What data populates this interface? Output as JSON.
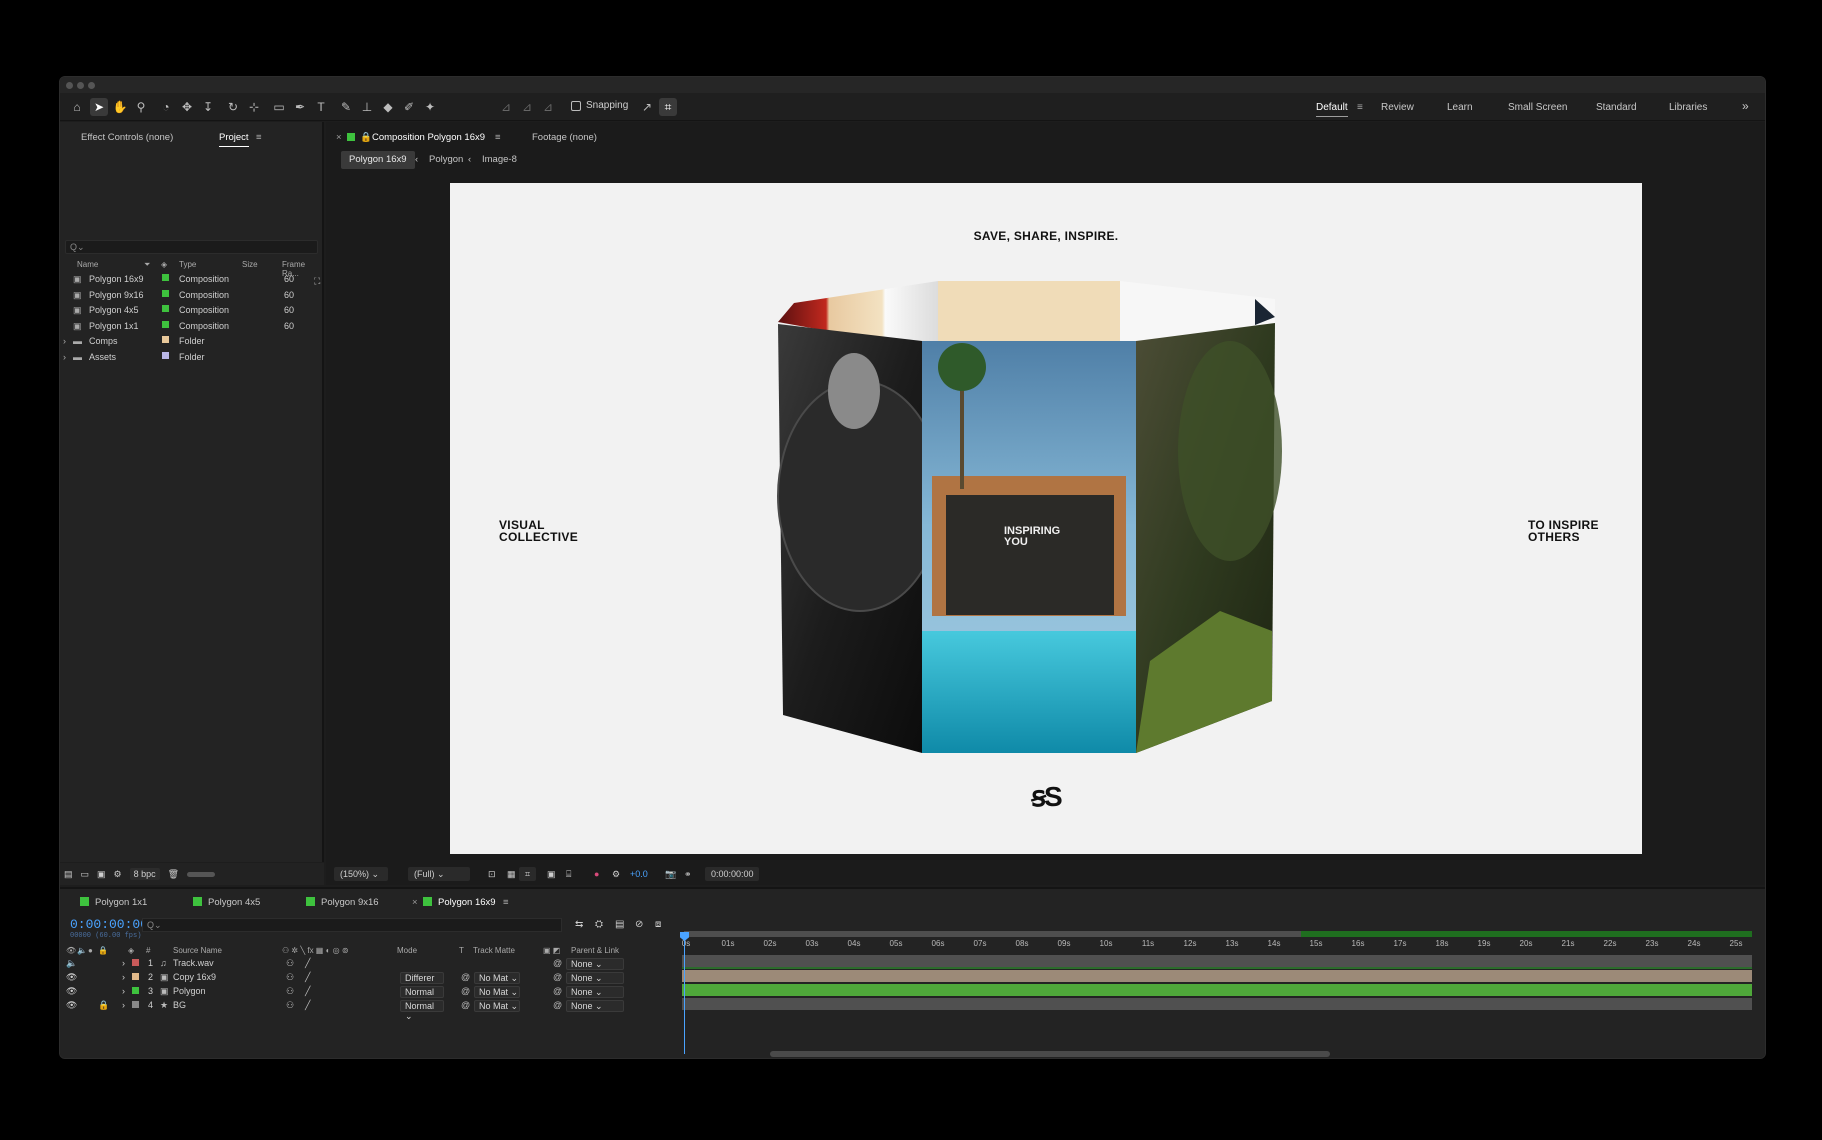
{
  "toolbar": {
    "snapping_label": "Snapping",
    "workspaces": [
      "Default",
      "Review",
      "Learn",
      "Small Screen",
      "Standard",
      "Libraries"
    ],
    "active_workspace": "Default",
    "more_icon": "»"
  },
  "left_panel": {
    "tabs": [
      "Effect Controls (none)",
      "Project"
    ],
    "search_placeholder": "Q⌄",
    "columns": [
      "Name",
      "Type",
      "Size",
      "Frame Ra..."
    ],
    "items": [
      {
        "name": "Polygon 16x9",
        "type": "Composition",
        "fps": "60",
        "color": "#3ec23e"
      },
      {
        "name": "Polygon 9x16",
        "type": "Composition",
        "fps": "60",
        "color": "#3ec23e"
      },
      {
        "name": "Polygon 4x5",
        "type": "Composition",
        "fps": "60",
        "color": "#3ec23e"
      },
      {
        "name": "Polygon 1x1",
        "type": "Composition",
        "fps": "60",
        "color": "#3ec23e"
      },
      {
        "name": "Comps",
        "type": "Folder",
        "fps": "",
        "color": "#e8c89a"
      },
      {
        "name": "Assets",
        "type": "Folder",
        "fps": "",
        "color": "#b9b6e6"
      }
    ],
    "bpc": "8 bpc"
  },
  "viewer": {
    "tabs": [
      "Composition Polygon 16x9",
      "Footage (none)"
    ],
    "breadcrumbs": [
      "Polygon 16x9",
      "Polygon",
      "Image-8"
    ],
    "zoom": "(150%)",
    "resolution": "(Full)",
    "exposure": "+0.0",
    "timecode": "0:00:00:00"
  },
  "canvas": {
    "headline": "SAVE, SHARE, INSPIRE.",
    "left_text_1": "VISUAL",
    "left_text_2": "COLLECTIVE",
    "right_text_1": "TO INSPIRE",
    "right_text_2": "OTHERS",
    "center_text_1": "INSPIRING",
    "center_text_2": "YOU",
    "logo": "ꞩS"
  },
  "timeline": {
    "tabs": [
      "Polygon 1x1",
      "Polygon 4x5",
      "Polygon 9x16",
      "Polygon 16x9"
    ],
    "active_tab": "Polygon 16x9",
    "timecode": "0:00:00:00",
    "timecode_sub": "00000 (60.00 fps)",
    "search_placeholder": "Q⌄",
    "columns": [
      "#",
      "Source Name",
      "Mode",
      "T",
      "Track Matte",
      "Parent & Link"
    ],
    "layers": [
      {
        "num": "1",
        "name": "Track.wav",
        "mode": "",
        "matte": "",
        "parent": "None",
        "color": "#c95a5a"
      },
      {
        "num": "2",
        "name": "Copy 16x9",
        "mode": "Differer",
        "matte": "No Mat",
        "parent": "None",
        "color": "#e0b98a"
      },
      {
        "num": "3",
        "name": "Polygon",
        "mode": "Normal",
        "matte": "No Mat",
        "parent": "None",
        "color": "#3ec23e"
      },
      {
        "num": "4",
        "name": "BG",
        "mode": "Normal",
        "matte": "No Mat",
        "parent": "None",
        "color": "#888888"
      }
    ],
    "ruler": [
      "0s",
      "01s",
      "02s",
      "03s",
      "04s",
      "05s",
      "06s",
      "07s",
      "08s",
      "09s",
      "10s",
      "11s",
      "12s",
      "13s",
      "14s",
      "15s",
      "16s",
      "17s",
      "18s",
      "19s",
      "20s",
      "21s",
      "22s",
      "23s",
      "24s",
      "25s"
    ]
  }
}
